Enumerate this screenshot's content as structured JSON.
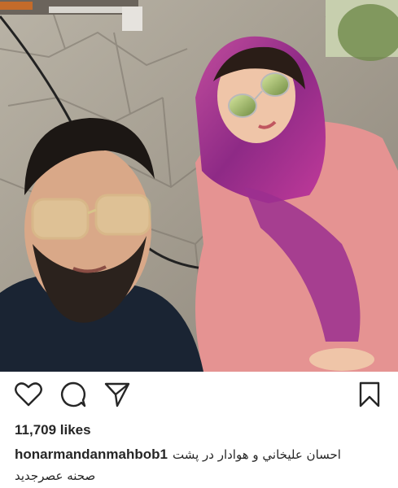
{
  "post": {
    "photo_alt": "photo-of-two-people",
    "likes": "11,709 likes",
    "username": "honarmandanmahbob1",
    "caption_line1": "احسان عليخاني و هوادار در پشت",
    "caption_line2": "صحنه عصرجديد"
  },
  "icons": {
    "like": "heart-icon",
    "comment": "comment-icon",
    "share": "send-icon",
    "save": "bookmark-icon"
  },
  "colors": {
    "text": "#262626",
    "background": "#ffffff"
  }
}
